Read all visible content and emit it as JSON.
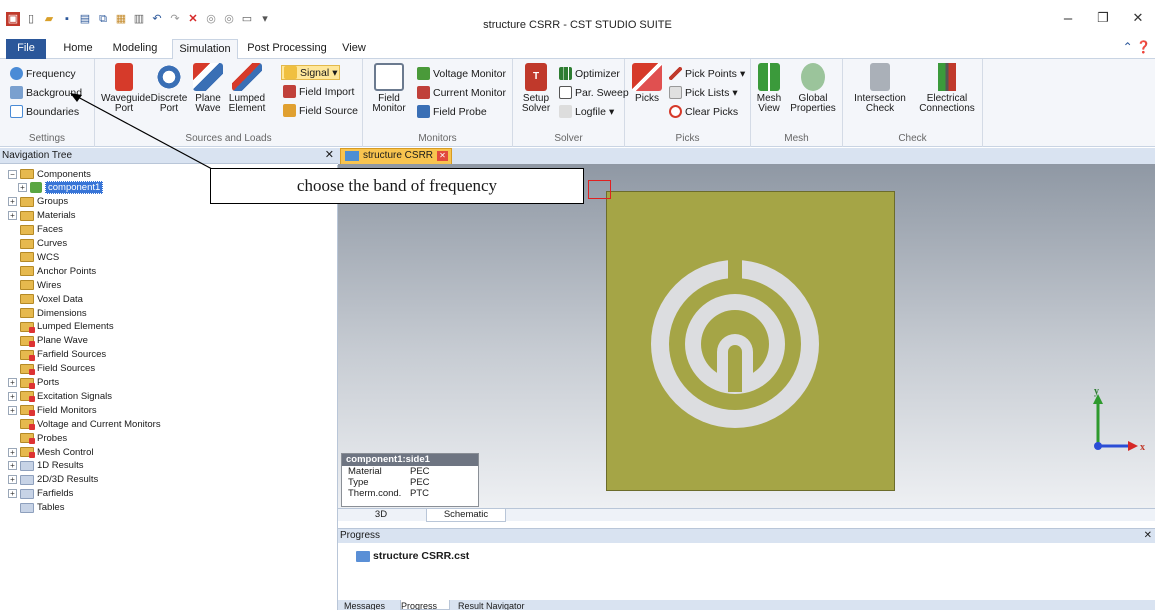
{
  "window": {
    "title": "structure CSRR - CST STUDIO SUITE",
    "controls": [
      "–",
      "❐",
      "✕"
    ]
  },
  "ribbon_tabs": [
    "File",
    "Home",
    "Modeling",
    "Simulation",
    "Post Processing",
    "View"
  ],
  "active_tab": "Simulation",
  "ribbon": {
    "settings": {
      "frequency": "Frequency",
      "background": "Background",
      "boundaries": "Boundaries",
      "label": "Settings"
    },
    "sources": {
      "waveguide_port": "Waveguide\nPort",
      "discrete_port": "Discrete\nPort",
      "plane_wave": "Plane\nWave",
      "lumped_element": "Lumped\nElement",
      "signal": "Signal",
      "field_import": "Field Import",
      "field_source": "Field Source",
      "label": "Sources and Loads"
    },
    "monitors": {
      "field_monitor": "Field\nMonitor",
      "voltage_monitor": "Voltage Monitor",
      "current_monitor": "Current Monitor",
      "field_probe": "Field Probe",
      "label": "Monitors"
    },
    "solver": {
      "setup_solver": "Setup\nSolver",
      "optimizer": "Optimizer",
      "par_sweep": "Par. Sweep",
      "logfile": "Logfile",
      "label": "Solver"
    },
    "picks": {
      "picks": "Picks",
      "pick_points": "Pick Points",
      "pick_lists": "Pick Lists",
      "clear_picks": "Clear Picks",
      "label": "Picks"
    },
    "mesh": {
      "mesh_view": "Mesh\nView",
      "global_properties": "Global\nProperties",
      "label": "Mesh"
    },
    "check": {
      "intersection_check": "Intersection\nCheck",
      "electrical_connections": "Electrical\nConnections",
      "label": "Check"
    }
  },
  "nav_tree": {
    "title": "Navigation Tree",
    "items": [
      {
        "label": "Components",
        "expander": "−",
        "icon": "folder"
      },
      {
        "label": "component1",
        "expander": "+",
        "icon": "component",
        "selected": true
      },
      {
        "label": "Groups",
        "expander": "+",
        "icon": "folder"
      },
      {
        "label": "Materials",
        "expander": "+",
        "icon": "folder"
      },
      {
        "label": "Faces",
        "expander": "",
        "icon": "folder"
      },
      {
        "label": "Curves",
        "expander": "",
        "icon": "folder"
      },
      {
        "label": "WCS",
        "expander": "",
        "icon": "folder"
      },
      {
        "label": "Anchor Points",
        "expander": "",
        "icon": "folder"
      },
      {
        "label": "Wires",
        "expander": "",
        "icon": "folder"
      },
      {
        "label": "Voxel Data",
        "expander": "",
        "icon": "folder"
      },
      {
        "label": "Dimensions",
        "expander": "",
        "icon": "folder"
      },
      {
        "label": "Lumped Elements",
        "expander": "",
        "icon": "folder-red"
      },
      {
        "label": "Plane Wave",
        "expander": "",
        "icon": "folder-red"
      },
      {
        "label": "Farfield Sources",
        "expander": "",
        "icon": "folder-red"
      },
      {
        "label": "Field Sources",
        "expander": "",
        "icon": "folder-red"
      },
      {
        "label": "Ports",
        "expander": "+",
        "icon": "folder-red"
      },
      {
        "label": "Excitation Signals",
        "expander": "+",
        "icon": "folder-red"
      },
      {
        "label": "Field Monitors",
        "expander": "+",
        "icon": "folder-red"
      },
      {
        "label": "Voltage and Current Monitors",
        "expander": "",
        "icon": "folder-red"
      },
      {
        "label": "Probes",
        "expander": "",
        "icon": "folder-red"
      },
      {
        "label": "Mesh Control",
        "expander": "+",
        "icon": "folder-red"
      },
      {
        "label": "1D Results",
        "expander": "+",
        "icon": "folder-blue"
      },
      {
        "label": "2D/3D Results",
        "expander": "+",
        "icon": "folder-blue"
      },
      {
        "label": "Farfields",
        "expander": "+",
        "icon": "folder-blue"
      },
      {
        "label": "Tables",
        "expander": "",
        "icon": "folder-blue"
      }
    ]
  },
  "document_tab": "structure CSRR",
  "info_panel": {
    "header": "component1:side1",
    "rows": [
      {
        "key": "Material",
        "value": "PEC"
      },
      {
        "key": "Type",
        "value": "PEC"
      },
      {
        "key": "Therm.cond.",
        "value": "PTC"
      }
    ]
  },
  "view_tabs": [
    "3D",
    "Schematic"
  ],
  "active_view_tab": "Schematic",
  "axes": {
    "y": "y",
    "x": "x"
  },
  "progress": {
    "title": "Progress",
    "item": "structure CSRR.cst"
  },
  "bottom_tabs": [
    "Messages",
    "Progress",
    "Result Navigator"
  ],
  "callout": "choose the band of frequency",
  "colors": {
    "substrate": "#a5a546",
    "ring": "#dcdde0",
    "accent": "#2b579a",
    "callout_border": "#000000",
    "pick_box": "#e02020"
  }
}
